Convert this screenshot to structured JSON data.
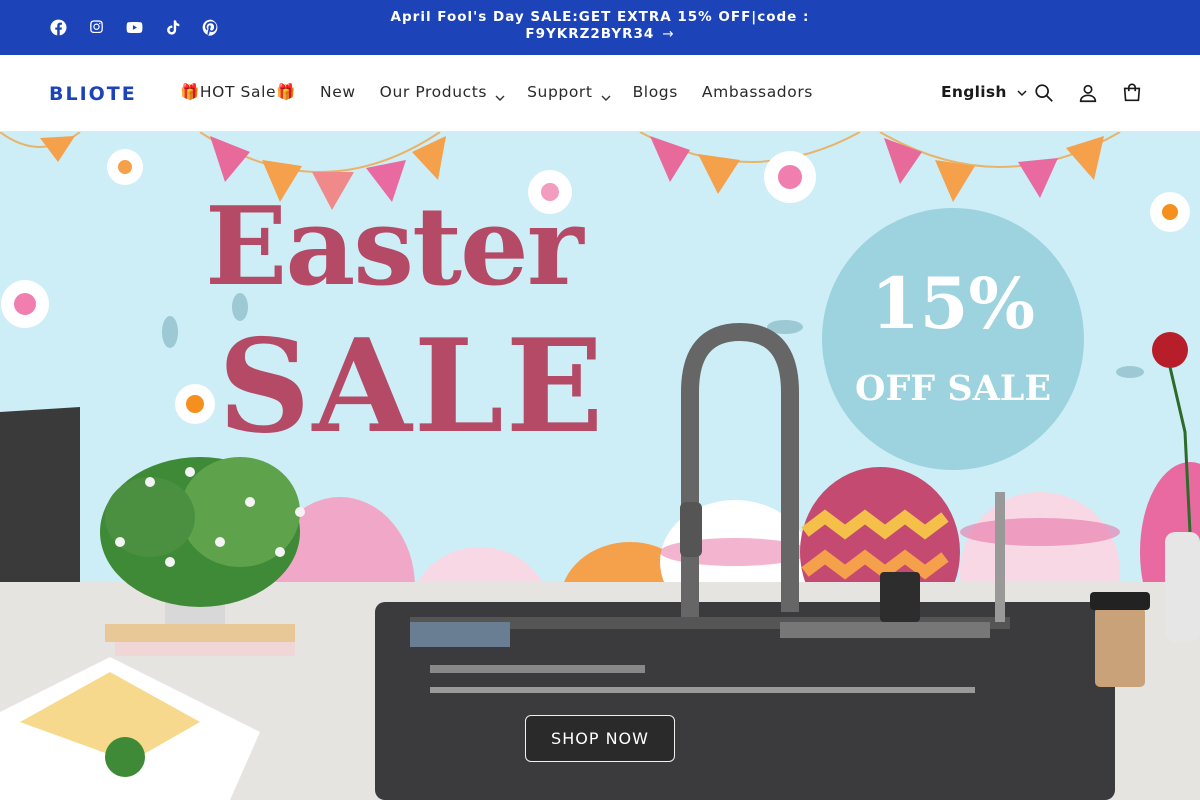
{
  "announcement": {
    "text": "April Fool's Day SALE:GET EXTRA 15% OFF|code : F9YKRZ2BYR34",
    "social_icons": [
      "facebook-icon",
      "instagram-icon",
      "youtube-icon",
      "tiktok-icon",
      "pinterest-icon"
    ]
  },
  "header": {
    "logo": "BLIOTE",
    "nav": [
      {
        "label": "🎁HOT Sale🎁",
        "dropdown": false
      },
      {
        "label": "New",
        "dropdown": false
      },
      {
        "label": "Our Products",
        "dropdown": true
      },
      {
        "label": "Support",
        "dropdown": true
      },
      {
        "label": "Blogs",
        "dropdown": false
      },
      {
        "label": "Ambassadors",
        "dropdown": false
      }
    ],
    "language": "English",
    "icons": [
      "search-icon",
      "account-icon",
      "cart-icon"
    ]
  },
  "hero": {
    "headline_1": "Easter",
    "headline_2": "SALE",
    "badge_percent": "15%",
    "badge_text": "OFF SALE",
    "cta": "SHOP NOW"
  },
  "colors": {
    "announcement_bg": "#1c44b8",
    "logo": "#1c44b8",
    "headline": "#b54a66",
    "hero_sky": "#cdeef6",
    "badge_circle": "#9cd3df"
  }
}
